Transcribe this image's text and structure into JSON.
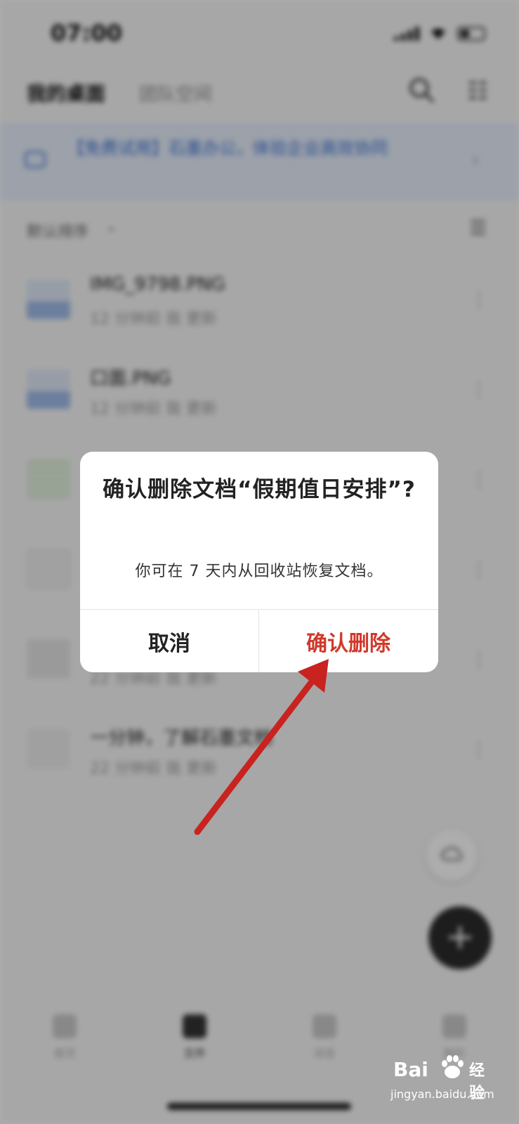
{
  "status_bar": {
    "time": "07:00"
  },
  "top_nav": {
    "tab_active": "我的桌面",
    "tab_inactive": "团队空间"
  },
  "banner": {
    "text": "【免费试用】石墨办公，体验企业高效协同"
  },
  "sort": {
    "label": "默认排序"
  },
  "files": [
    {
      "name": "IMG_9798.PNG",
      "meta": "12 分钟前 我 更新",
      "thumb": "image"
    },
    {
      "name": "口面.PNG",
      "meta": "12 分钟前 我 更新",
      "thumb": "image"
    },
    {
      "name": "",
      "meta": "",
      "thumb": "sheet"
    },
    {
      "name": "",
      "meta": "",
      "thumb": "doc"
    },
    {
      "name": "",
      "meta": "22 分钟前 我 更新",
      "thumb": "gray"
    },
    {
      "name": "一分钟，了解石墨文档",
      "meta": "22 分钟前 我 更新",
      "thumb": "doc2"
    }
  ],
  "bottom_nav": {
    "items": [
      {
        "label": "首页",
        "icon": "home-icon"
      },
      {
        "label": "文件",
        "icon": "folder-icon"
      },
      {
        "label": "消息",
        "icon": "message-icon"
      },
      {
        "label": "我的",
        "icon": "profile-icon"
      }
    ]
  },
  "dialog": {
    "title": "确认删除文档“假期值日安排”?",
    "message": "你可在 7 天内从回收站恢复文档。",
    "cancel_label": "取消",
    "confirm_label": "确认删除"
  },
  "watermark": {
    "brand": "Bai",
    "brand2": "经验",
    "sub": "jingyan.baidu.com"
  },
  "colors": {
    "confirm": "#d0392b",
    "arrow": "#c8231f",
    "banner_text": "#3d6fd1",
    "fab": "#2b2b2b"
  }
}
